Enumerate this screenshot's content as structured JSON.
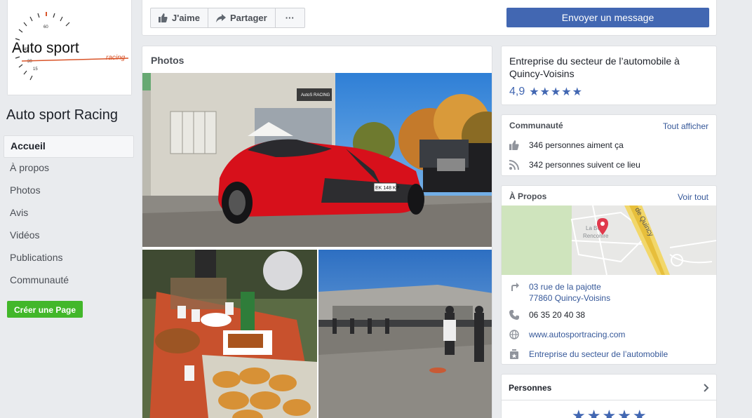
{
  "left": {
    "logo": {
      "main_text": "Auto sport",
      "sub_text": "racing",
      "gauge_numbers": [
        "60",
        "45",
        "30",
        "15"
      ]
    },
    "page_name": "Auto sport Racing",
    "nav": [
      "Accueil",
      "À propos",
      "Photos",
      "Avis",
      "Vidéos",
      "Publications",
      "Communauté"
    ],
    "create_page": "Créer une Page"
  },
  "actions": {
    "like": "J'aime",
    "share": "Partager",
    "more": "···",
    "message": "Envoyer un message"
  },
  "photos": {
    "title": "Photos",
    "main_photo": {
      "plate": "EK 148 KP",
      "sign": "AutoS RACING"
    }
  },
  "about_summary": {
    "category": "Entreprise du secteur de l’automobile à Quincy-Voisins",
    "rating": "4,9",
    "stars": "★★★★★"
  },
  "community": {
    "title": "Communauté",
    "see_all": "Tout afficher",
    "likes": "346 personnes aiment ça",
    "follows": "342 personnes suivent ce lieu"
  },
  "about": {
    "title": "À Propos",
    "see_all": "Voir tout",
    "map": {
      "place": "La Bo",
      "place2": "Renconire",
      "road": "de Quincy"
    },
    "address_line1": "03 rue de la pajotte",
    "address_line2": "77860 Quincy-Voisins",
    "phone": "06 35 20 40 38",
    "website": "www.autosportracing.com",
    "category": "Entreprise du secteur de l’automobile"
  },
  "people": {
    "title": "Personnes",
    "stars": "★★★★★"
  },
  "colors": {
    "primary": "#4267b2",
    "link": "#365899",
    "green": "#42b72a",
    "background": "#e9ebee",
    "map_pin": "#e0394c"
  }
}
